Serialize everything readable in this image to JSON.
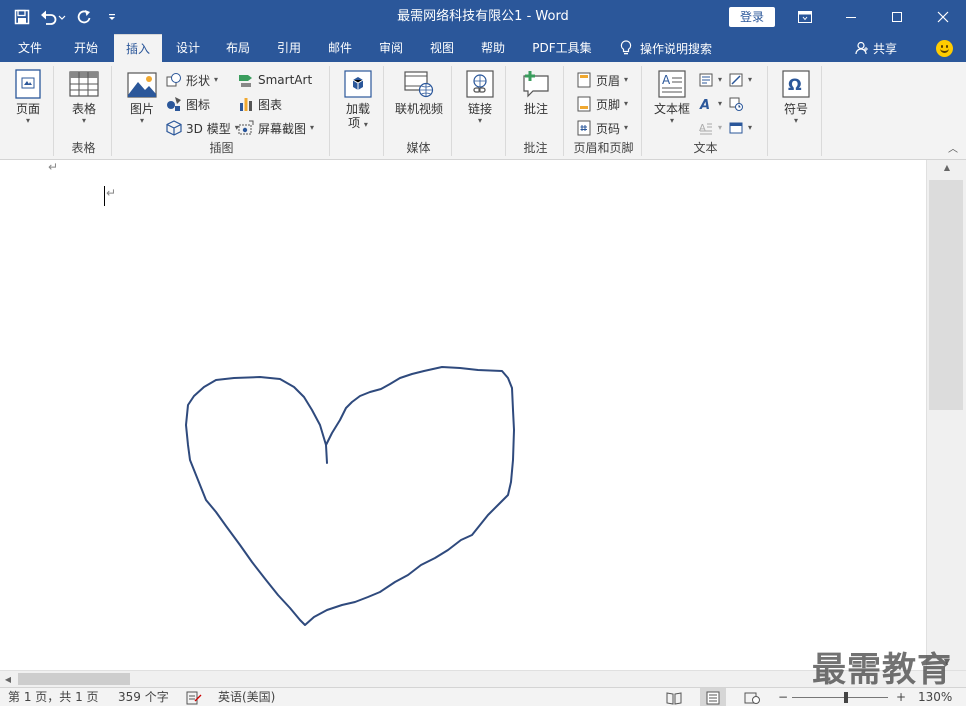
{
  "window": {
    "title": "最需网络科技有限公1  -  Word",
    "login_label": "登录"
  },
  "tabs": [
    {
      "label": "文件"
    },
    {
      "label": "开始"
    },
    {
      "label": "插入"
    },
    {
      "label": "设计"
    },
    {
      "label": "布局"
    },
    {
      "label": "引用"
    },
    {
      "label": "邮件"
    },
    {
      "label": "审阅"
    },
    {
      "label": "视图"
    },
    {
      "label": "帮助"
    },
    {
      "label": "PDF工具集"
    }
  ],
  "active_tab": "插入",
  "tell_me": "操作说明搜索",
  "share": "共享",
  "ribbon": {
    "pages": {
      "label": "页面"
    },
    "table": {
      "label": "表格",
      "group": "表格"
    },
    "illustrations": {
      "group": "插图",
      "picture": "图片",
      "shapes": "形状",
      "icons": "图标",
      "model3d": "3D 模型",
      "smartart": "SmartArt",
      "chart": "图表",
      "screenshot": "屏幕截图"
    },
    "addins": {
      "label_line1": "加载",
      "label_line2": "项"
    },
    "media": {
      "group": "媒体",
      "online_video": "联机视频"
    },
    "links": {
      "label": "链接"
    },
    "comments": {
      "group": "批注",
      "comment": "批注"
    },
    "header_footer": {
      "group": "页眉和页脚",
      "header": "页眉",
      "footer": "页脚",
      "page_number": "页码"
    },
    "text": {
      "group": "文本",
      "textbox": "文本框"
    },
    "symbols": {
      "label": "符号"
    }
  },
  "document": {
    "return_glyph": "↵"
  },
  "watermark": "最需教育",
  "status": {
    "page": "第 1 页，共 1 页",
    "words": "359 个字",
    "language": "英语(美国)",
    "zoom_minus": "−",
    "zoom_plus": "+",
    "zoom": "130%"
  },
  "colors": {
    "brand": "#2b579a",
    "ink": "#2f4a7d"
  }
}
